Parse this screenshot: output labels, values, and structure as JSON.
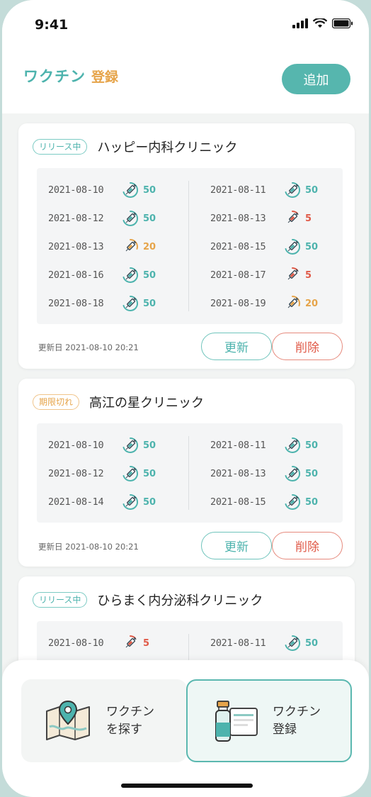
{
  "status_bar": {
    "time": "9:41"
  },
  "header": {
    "title_main": "ワクチン",
    "title_sub": "登録",
    "add_label": "追加"
  },
  "cards": [
    {
      "badge": "リリース中",
      "badge_type": "release",
      "clinic": "ハッピー内科クリニック",
      "rows": [
        {
          "left": {
            "date": "2021-08-10",
            "count": "50",
            "level": "g"
          },
          "right": {
            "date": "2021-08-11",
            "count": "50",
            "level": "g"
          }
        },
        {
          "left": {
            "date": "2021-08-12",
            "count": "50",
            "level": "g"
          },
          "right": {
            "date": "2021-08-13",
            "count": "5",
            "level": "r"
          }
        },
        {
          "left": {
            "date": "2021-08-13",
            "count": "20",
            "level": "o"
          },
          "right": {
            "date": "2021-08-15",
            "count": "50",
            "level": "g"
          }
        },
        {
          "left": {
            "date": "2021-08-16",
            "count": "50",
            "level": "g"
          },
          "right": {
            "date": "2021-08-17",
            "count": "5",
            "level": "r"
          }
        },
        {
          "left": {
            "date": "2021-08-18",
            "count": "50",
            "level": "g"
          },
          "right": {
            "date": "2021-08-19",
            "count": "20",
            "level": "o"
          }
        }
      ],
      "updated": "更新日 2021-08-10 20:21",
      "update_label": "更新",
      "delete_label": "削除"
    },
    {
      "badge": "期限切れ",
      "badge_type": "expired",
      "clinic": "高江の星クリニック",
      "rows": [
        {
          "left": {
            "date": "2021-08-10",
            "count": "50",
            "level": "g"
          },
          "right": {
            "date": "2021-08-11",
            "count": "50",
            "level": "g"
          }
        },
        {
          "left": {
            "date": "2021-08-12",
            "count": "50",
            "level": "g"
          },
          "right": {
            "date": "2021-08-13",
            "count": "50",
            "level": "g"
          }
        },
        {
          "left": {
            "date": "2021-08-14",
            "count": "50",
            "level": "g"
          },
          "right": {
            "date": "2021-08-15",
            "count": "50",
            "level": "g"
          }
        }
      ],
      "updated": "更新日 2021-08-10 20:21",
      "update_label": "更新",
      "delete_label": "削除"
    },
    {
      "badge": "リリース中",
      "badge_type": "release",
      "clinic": "ひらまく内分泌科クリニック",
      "rows": [
        {
          "left": {
            "date": "2021-08-10",
            "count": "5",
            "level": "r"
          },
          "right": {
            "date": "2021-08-11",
            "count": "50",
            "level": "g"
          }
        }
      ]
    }
  ],
  "bottom_nav": {
    "search_line1": "ワクチン",
    "search_line2": "を探す",
    "register_line1": "ワクチン",
    "register_line2": "登録"
  },
  "colors": {
    "green": "#4db3ad",
    "orange": "#e6a44a",
    "red": "#e05a48"
  }
}
